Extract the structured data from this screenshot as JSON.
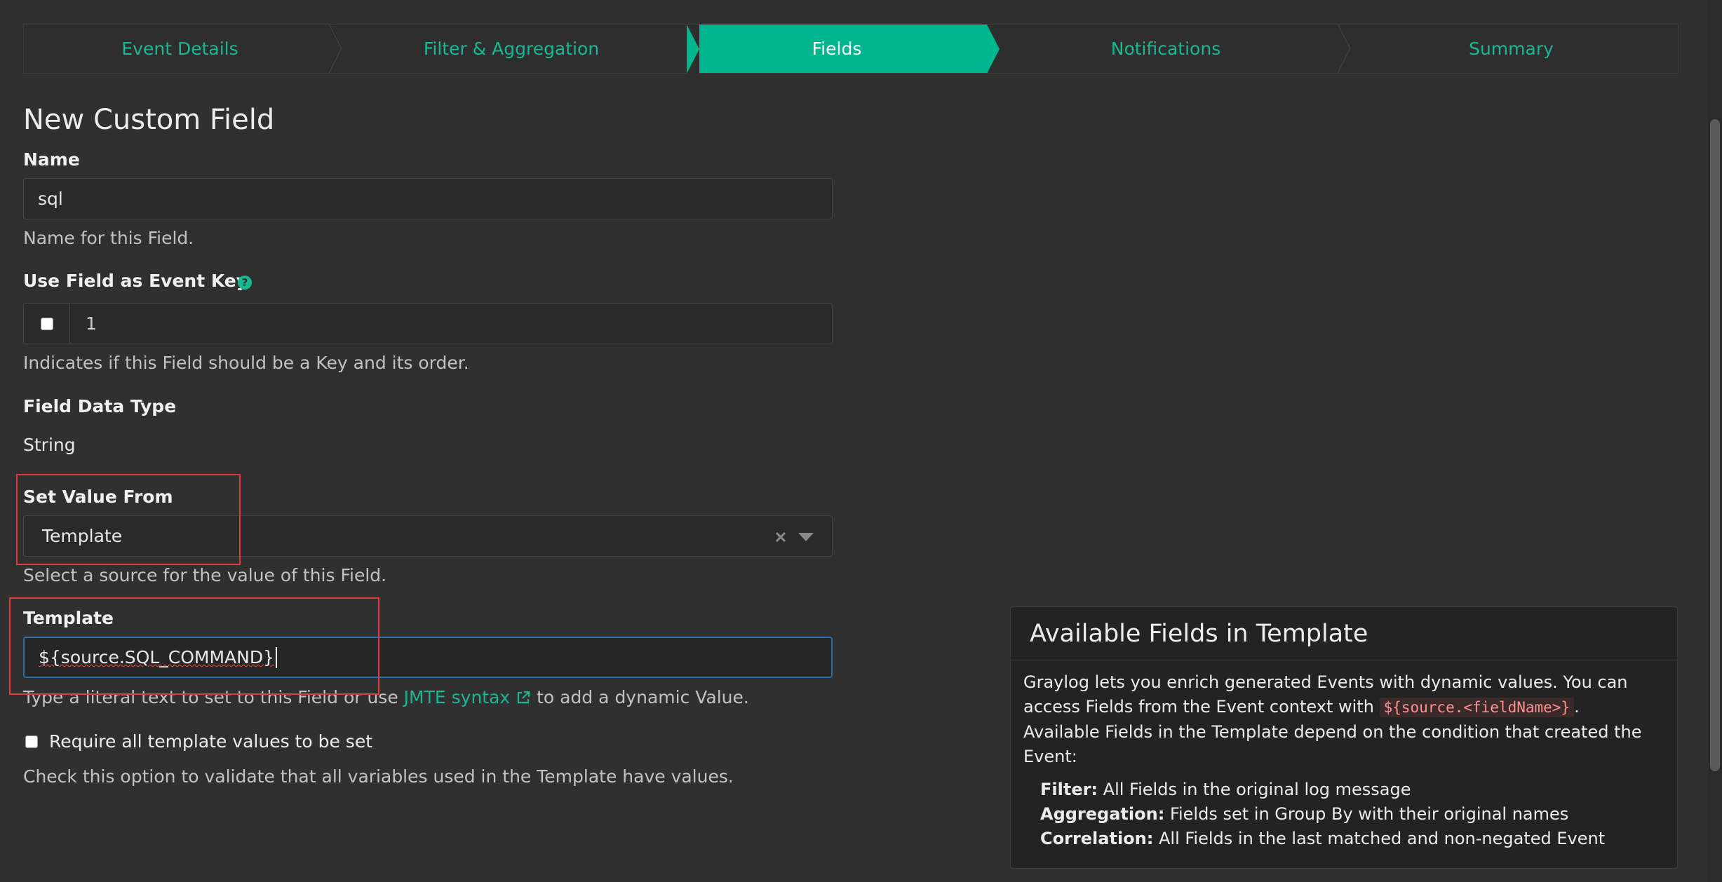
{
  "wizard": {
    "steps": [
      {
        "label": "Event Details"
      },
      {
        "label": "Filter & Aggregation"
      },
      {
        "label": "Fields"
      },
      {
        "label": "Notifications"
      },
      {
        "label": "Summary"
      }
    ],
    "active_step": "Fields",
    "accent_color": "#00b68f"
  },
  "form": {
    "title": "New Custom Field",
    "name": {
      "label": "Name",
      "value": "sql",
      "help": "Name for this Field."
    },
    "event_key": {
      "label": "Use Field as Event Key",
      "help_icon": "question-circle-icon",
      "order_value": "1",
      "help": "Indicates if this Field should be a Key and its order."
    },
    "data_type": {
      "label": "Field Data Type",
      "value": "String"
    },
    "set_value_from": {
      "label": "Set Value From",
      "value": "Template",
      "help": "Select a source for the value of this Field."
    },
    "template": {
      "label": "Template",
      "value": "${source.SQL_COMMAND}",
      "help_before": "Type a literal text to set to this Field or use",
      "help_link": "JMTE syntax",
      "help_after": "to add a dynamic Value."
    },
    "require_all": {
      "label": "Require all template values to be set",
      "help": "Check this option to validate that all variables used in the Template have values."
    }
  },
  "panel": {
    "title": "Available Fields in Template",
    "intro_1": "Graylog lets you enrich generated Events with dynamic values. You can access Fields from the Event context with",
    "code": "${source.<fieldName>}",
    "intro_2": ".",
    "intro_3": "Available Fields in the Template depend on the condition that created the Event:",
    "items": [
      {
        "term": "Filter:",
        "desc": "All Fields in the original log message"
      },
      {
        "term": "Aggregation:",
        "desc": "Fields set in Group By with their original names"
      },
      {
        "term": "Correlation:",
        "desc": "All Fields in the last matched and non-negated Event"
      }
    ]
  }
}
